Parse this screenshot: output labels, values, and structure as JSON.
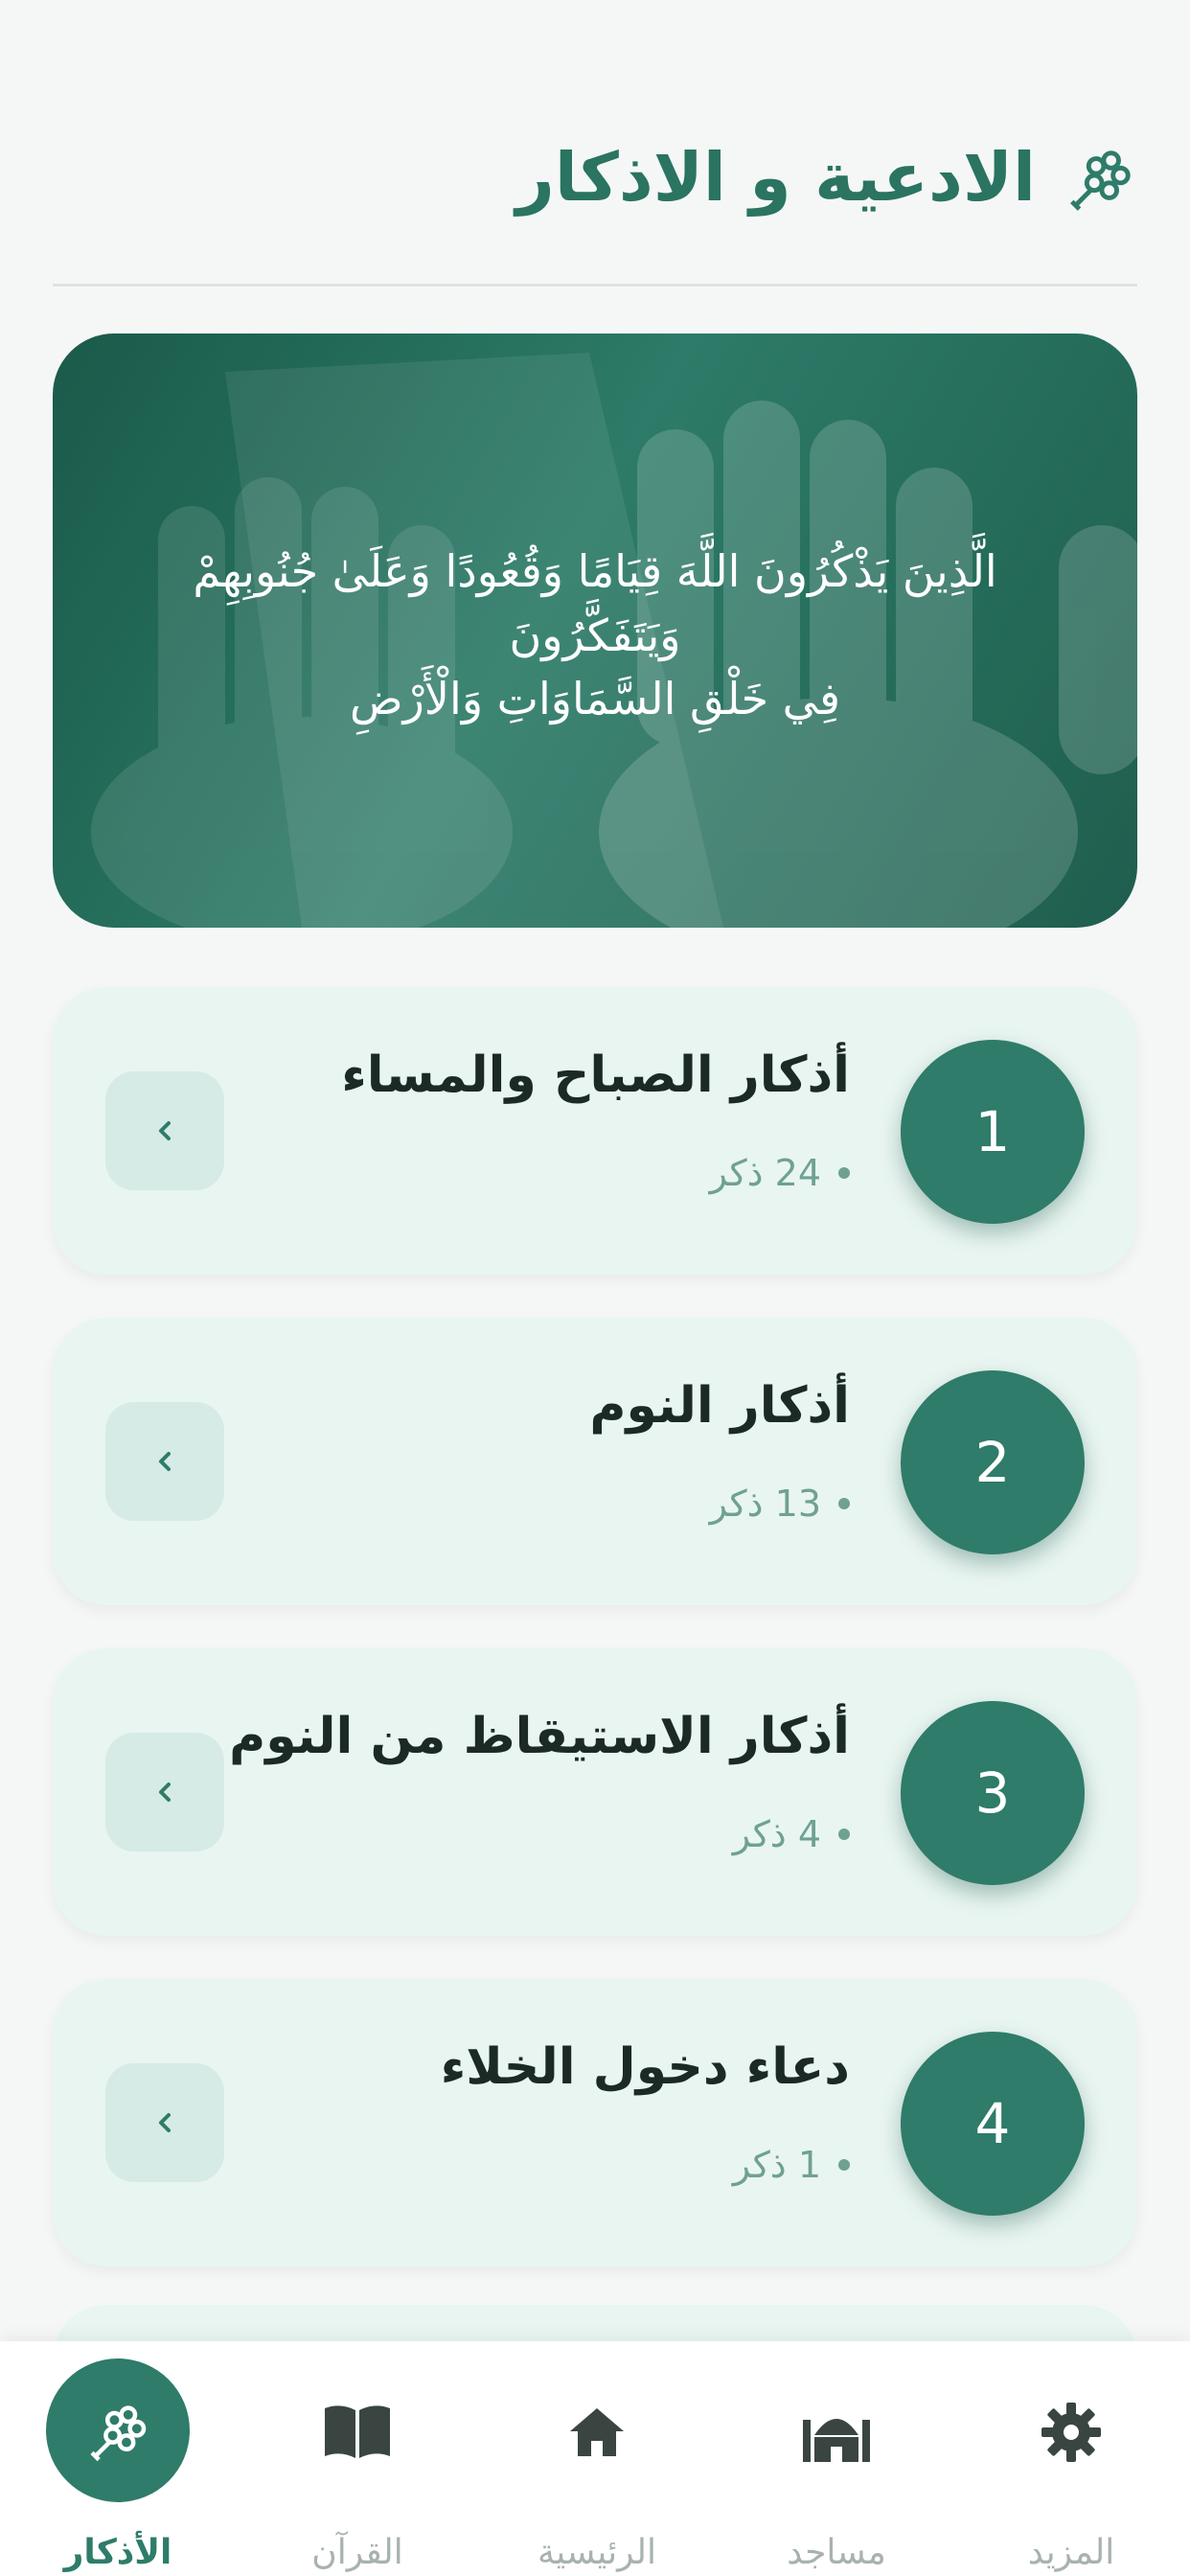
{
  "header": {
    "title": "الادعية و الاذكار",
    "icon": "tasbih-icon"
  },
  "banner": {
    "verse_line1": "الَّذِينَ يَذْكُرُونَ اللَّهَ قِيَامًا وَقُعُودًا وَعَلَىٰ جُنُوبِهِمْ وَيَتَفَكَّرُونَ",
    "verse_line2": "فِي خَلْقِ السَّمَاوَاتِ وَالْأَرْضِ"
  },
  "cards": [
    {
      "number": "1",
      "title": "أذكار الصباح والمساء",
      "count": "24 ذكر"
    },
    {
      "number": "2",
      "title": "أذكار النوم",
      "count": "13 ذكر"
    },
    {
      "number": "3",
      "title": "أذكار الاستيقاظ من النوم",
      "count": "4 ذكر"
    },
    {
      "number": "4",
      "title": "دعاء دخول الخلاء",
      "count": "1 ذكر"
    }
  ],
  "nav": {
    "more": "المزيد",
    "mosques": "مساجد",
    "home": "الرئيسية",
    "quran": "القرآن",
    "azkar": "الأذكار"
  },
  "colors": {
    "accent": "#2e7c69",
    "card_bg": "#e9f5f1",
    "muted": "#a8b2af"
  }
}
